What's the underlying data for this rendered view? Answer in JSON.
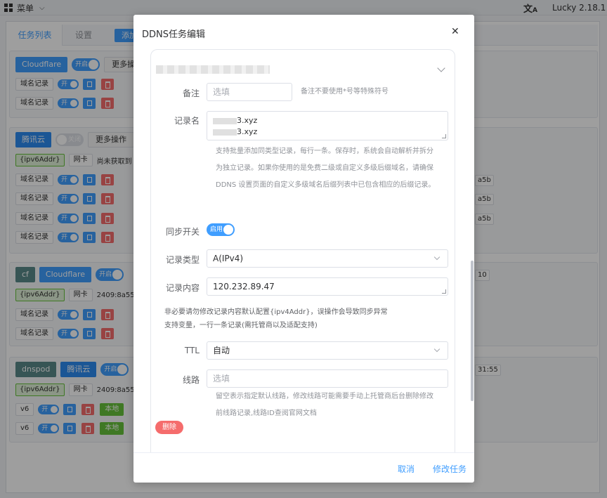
{
  "topbar": {
    "menu_label": "菜单",
    "language_icon": "translate-icon",
    "version": "Lucky 2.18.1"
  },
  "tabs": [
    {
      "label": "任务列表",
      "active": true
    },
    {
      "label": "设置",
      "active": false
    },
    {
      "label": "添加"
    }
  ],
  "groups": [
    {
      "provider": "Cloudflare",
      "switch": "开启",
      "more": "更多操",
      "records": [
        {
          "label": "域名记录",
          "switch": "开"
        },
        {
          "label": "域名记录",
          "switch": "开"
        }
      ]
    },
    {
      "provider": "腾讯云",
      "switch": "关闭",
      "more": "更多操作",
      "addr_tag": "{ipv6Addr}",
      "nic": "网卡",
      "status": "尚未获取到",
      "records": [
        {
          "label": "域名记录",
          "switch": "开",
          "side": "a5b"
        },
        {
          "label": "域名记录",
          "switch": "开",
          "side": "a5b"
        },
        {
          "label": "域名记录",
          "switch": "开",
          "side": "a5b"
        },
        {
          "label": "域名记录",
          "switch": "开"
        }
      ]
    },
    {
      "prefix": "cf",
      "provider": "Cloudflare",
      "switch": "开启",
      "addr_tag": "{ipv6Addr}",
      "nic": "网卡",
      "addr": "2409:8a55",
      "side": "10",
      "records": [
        {
          "label": "域名记录",
          "switch": "开"
        },
        {
          "label": "域名记录",
          "switch": "开"
        }
      ]
    },
    {
      "prefix": "dnspod",
      "provider": "腾讯云",
      "switch": "开启",
      "addr_tag": "{ipv6Addr}",
      "nic": "网卡",
      "addr": "2409:8a55",
      "side": "31:55",
      "records": [
        {
          "label": "v6",
          "switch": "开",
          "extra": "本地"
        },
        {
          "label": "v6",
          "switch": "开",
          "extra": "本地"
        }
      ]
    }
  ],
  "dialog": {
    "title": "DDNS任务编辑",
    "close_icon": "close-icon",
    "form": {
      "remark_label": "备注",
      "remark_placeholder": "选填",
      "remark_hint": "备注不要使用*号等特殊符号",
      "record_name_label": "记录名",
      "record_name_lines": [
        "3.xyz",
        "3.xyz"
      ],
      "record_name_hint_lines": [
        "支持批量添加同类型记录，每行一条。保存时，系统会自动解析并拆分",
        "为独立记录。如果你使用的是免费二级或自定义多级后缀域名，请确保",
        "DDNS 设置页面的自定义多级域名后缀列表中已包含相应的后缀记录。"
      ],
      "sync_label": "同步开关",
      "sync_switch": "启用",
      "record_type_label": "记录类型",
      "record_type_value": "A(IPv4)",
      "record_content_label": "记录内容",
      "record_content_value": "120.232.89.47",
      "record_content_hint_lines": [
        "非必要请勿修改记录内容默认配置{ipv4Addr}，误操作会导致同步异常",
        "支持变量，一行一条记录(需托管商以及适配支持)"
      ],
      "ttl_label": "TTL",
      "ttl_value": "自动",
      "line_label": "线路",
      "line_placeholder": "选填",
      "line_hint_lines": [
        "留空表示指定默认线路，修改线路可能需要手动上托管商后台删除修改",
        "前线路记录,线路ID查阅官网文档"
      ],
      "delete_label": "删除"
    },
    "cancel_label": "取消",
    "submit_label": "修改任务"
  }
}
